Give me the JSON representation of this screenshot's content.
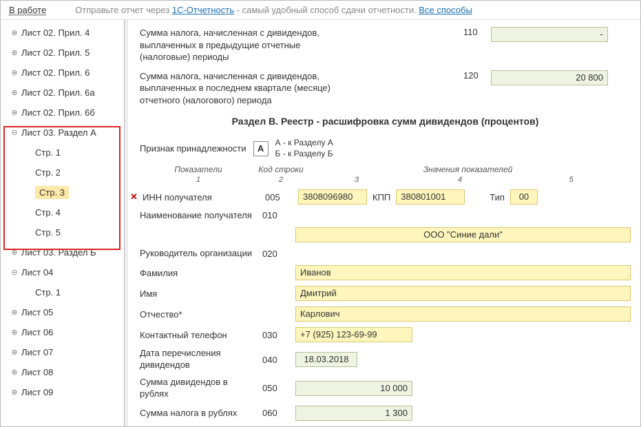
{
  "topbar": {
    "status": "В работе",
    "hint_prefix": "Отправьте отчет через ",
    "link1": "1С-Отчетность",
    "hint_suffix": " - самый удобный способ сдачи отчетности. ",
    "link2": "Все способы"
  },
  "tree": [
    {
      "label": "Лист 02. Прил. 4",
      "toggle": "⊕"
    },
    {
      "label": "Лист 02. Прил. 5",
      "toggle": "⊕"
    },
    {
      "label": "Лист 02. Прил. 6",
      "toggle": "⊕"
    },
    {
      "label": "Лист 02. Прил. 6а",
      "toggle": "⊕"
    },
    {
      "label": "Лист 02. Прил. 6б",
      "toggle": "⊕"
    },
    {
      "label": "Лист 03. Раздел А",
      "toggle": "⊖"
    },
    {
      "label": "Стр. 1",
      "child": true
    },
    {
      "label": "Стр. 2",
      "child": true
    },
    {
      "label": "Стр. 3",
      "child": true,
      "selected": true
    },
    {
      "label": "Стр. 4",
      "child": true
    },
    {
      "label": "Стр. 5",
      "child": true
    },
    {
      "label": "Лист 03. Раздел Б",
      "toggle": "⊕"
    },
    {
      "label": "Лист 04",
      "toggle": "⊖"
    },
    {
      "label": "Стр. 1",
      "child": true
    },
    {
      "label": "Лист 05",
      "toggle": "⊕"
    },
    {
      "label": "Лист 06",
      "toggle": "⊕"
    },
    {
      "label": "Лист 07",
      "toggle": "⊕"
    },
    {
      "label": "Лист 08",
      "toggle": "⊕"
    },
    {
      "label": "Лист 09",
      "toggle": "⊕"
    }
  ],
  "toprows": [
    {
      "label": "Сумма налога, начисленная с дивидендов, выплаченных в предыдущие отчетные (налоговые) периоды",
      "code": "110",
      "value": "-"
    },
    {
      "label": "Сумма налога, начисленная с дивидендов, выплаченных в последнем квартале (месяце) отчетного (налогового) периода",
      "code": "120",
      "value": "20 800"
    }
  ],
  "section_title": "Раздел В. Реестр - расшифровка сумм дивидендов (процентов)",
  "priznak": {
    "label": "Признак принадлежности",
    "value": "А",
    "legendA": "А - к Разделу А",
    "legendB": "Б - к Разделу Б"
  },
  "colheads": {
    "c1": "Показатели",
    "c2": "Код строки",
    "c3": "Значения показателей"
  },
  "colnums": {
    "n1": "1",
    "n2": "2",
    "n3": "3",
    "n4": "4",
    "n5": "5"
  },
  "inn_row": {
    "label": "ИНН получателя",
    "code": "005",
    "inn": "3808096980",
    "kpp_label": "КПП",
    "kpp": "380801001",
    "tip_label": "Тип",
    "tip": "00"
  },
  "name_row": {
    "label": "Наименование получателя",
    "code": "010",
    "value": "ООО \"Синие дали\""
  },
  "ruk_row": {
    "label": "Руководитель организации",
    "code": "020"
  },
  "fam": {
    "label": "Фамилия",
    "value": "Иванов"
  },
  "im": {
    "label": "Имя",
    "value": "Дмитрий"
  },
  "ot": {
    "label": "Отчество*",
    "value": "Карлович"
  },
  "phone": {
    "label": "Контактный телефон",
    "code": "030",
    "value": "+7 (925) 123-69-99"
  },
  "date": {
    "label": "Дата перечисления дивидендов",
    "code": "040",
    "value": "18.03.2018"
  },
  "sumdiv": {
    "label": "Сумма дивидендов в рублях",
    "code": "050",
    "value": "10 000"
  },
  "sumnal": {
    "label": "Сумма налога в рублях",
    "code": "060",
    "value": "1 300"
  }
}
